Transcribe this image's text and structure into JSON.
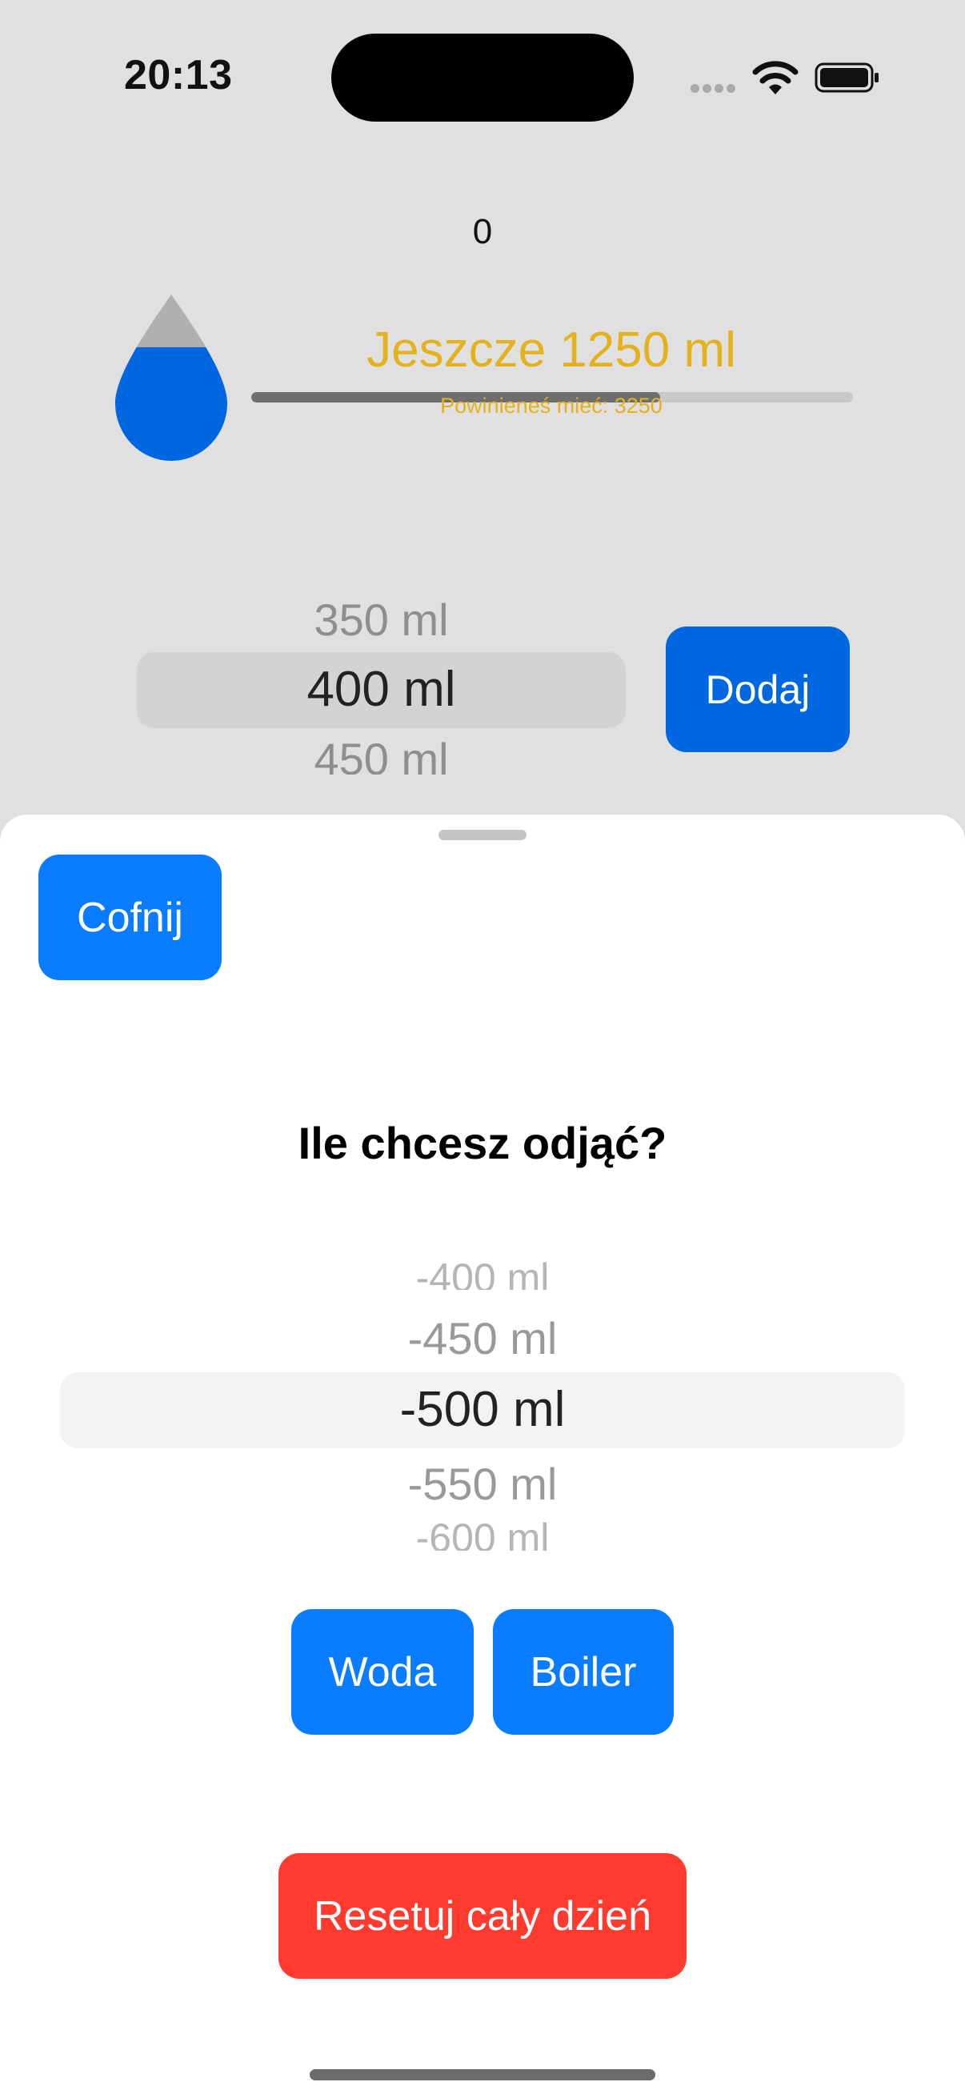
{
  "status_bar": {
    "time": "20:13"
  },
  "main": {
    "counter": "0",
    "remaining": "Jeszcze 1250 ml",
    "goal": "Powinieneś mieć: 3250",
    "progress_fraction": 0.68,
    "colors": {
      "accent": "#e3b21c",
      "water": "#0067e0"
    }
  },
  "top_picker": {
    "previous": "350 ml",
    "selected": "400 ml",
    "next": "450 ml"
  },
  "add_button_label": "Dodaj",
  "sheet": {
    "back_button_label": "Cofnij",
    "title": "Ile chcesz odjąć?",
    "picker": {
      "top_faded": "-400 ml",
      "previous": "-450 ml",
      "selected": "-500 ml",
      "next": "-550 ml",
      "bottom_faded": "-600 ml"
    },
    "water_button_label": "Woda",
    "boiler_button_label": "Boiler",
    "reset_button_label": "Resetuj cały dzień"
  }
}
